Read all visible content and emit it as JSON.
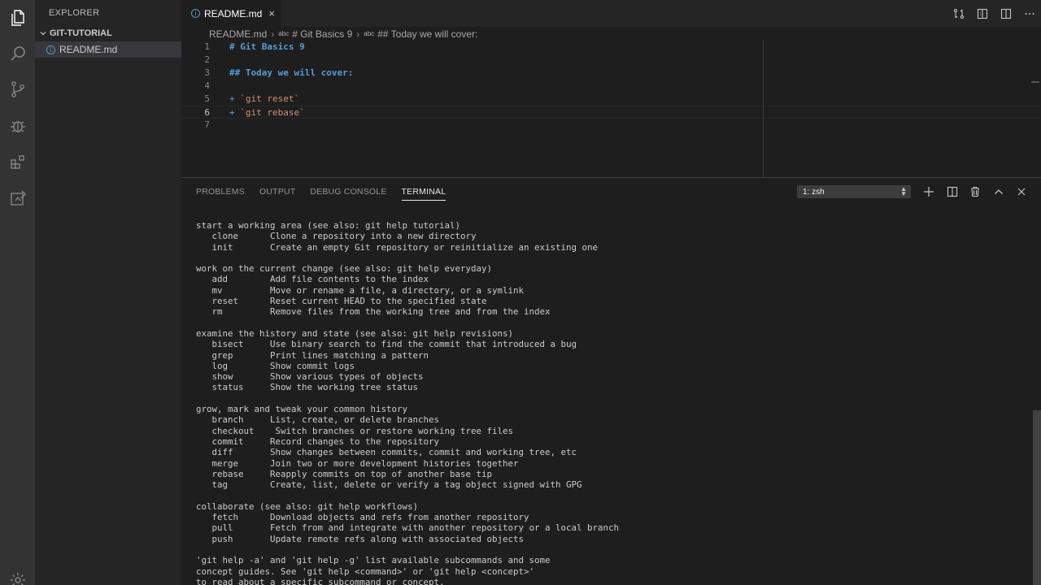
{
  "activity_bar": {
    "items": [
      {
        "icon": "files-icon"
      },
      {
        "icon": "search-icon"
      },
      {
        "icon": "source-control-icon"
      },
      {
        "icon": "debug-icon"
      },
      {
        "icon": "extensions-icon"
      },
      {
        "icon": "remote-explorer-icon"
      },
      {
        "icon": "gear-icon"
      }
    ]
  },
  "sidebar": {
    "title": "EXPLORER",
    "folder": "GIT-TUTORIAL",
    "files": [
      {
        "name": "README.md",
        "icon": "info-icon"
      }
    ]
  },
  "editor": {
    "tab": {
      "label": "README.md",
      "close": "×"
    },
    "breadcrumb": {
      "file": "README.md",
      "symbol_prefix": "abc",
      "symbol1": "# Git Basics 9",
      "symbol2": "## Today we will cover:"
    },
    "lines": [
      {
        "n": "1",
        "text": "# Git Basics 9"
      },
      {
        "n": "2",
        "text": ""
      },
      {
        "n": "3",
        "text": "## Today we will cover:"
      },
      {
        "n": "4",
        "text": ""
      },
      {
        "n": "5",
        "plus": "+",
        "text": "`git reset`"
      },
      {
        "n": "6",
        "plus": "+",
        "text": "`git rebase`"
      },
      {
        "n": "7",
        "text": ""
      }
    ],
    "current_line": "6"
  },
  "panel": {
    "tabs": [
      "PROBLEMS",
      "OUTPUT",
      "DEBUG CONSOLE",
      "TERMINAL"
    ],
    "active_tab": "TERMINAL",
    "terminal_select": "1: zsh",
    "terminal_lines": [
      "start a working area (see also: git help tutorial)",
      "   clone      Clone a repository into a new directory",
      "   init       Create an empty Git repository or reinitialize an existing one",
      "",
      "work on the current change (see also: git help everyday)",
      "   add        Add file contents to the index",
      "   mv         Move or rename a file, a directory, or a symlink",
      "   reset      Reset current HEAD to the specified state",
      "   rm         Remove files from the working tree and from the index",
      "",
      "examine the history and state (see also: git help revisions)",
      "   bisect     Use binary search to find the commit that introduced a bug",
      "   grep       Print lines matching a pattern",
      "   log        Show commit logs",
      "   show       Show various types of objects",
      "   status     Show the working tree status",
      "",
      "grow, mark and tweak your common history",
      "   branch     List, create, or delete branches",
      "   checkout    Switch branches or restore working tree files",
      "   commit     Record changes to the repository",
      "   diff       Show changes between commits, commit and working tree, etc",
      "   merge      Join two or more development histories together",
      "   rebase     Reapply commits on top of another base tip",
      "   tag        Create, list, delete or verify a tag object signed with GPG",
      "",
      "collaborate (see also: git help workflows)",
      "   fetch      Download objects and refs from another repository",
      "   pull       Fetch from and integrate with another repository or a local branch",
      "   push       Update remote refs along with associated objects",
      "",
      "'git help -a' and 'git help -g' list available subcommands and some",
      "concept guides. See 'git help <command>' or 'git help <concept>'",
      "to read about a specific subcommand or concept."
    ]
  }
}
